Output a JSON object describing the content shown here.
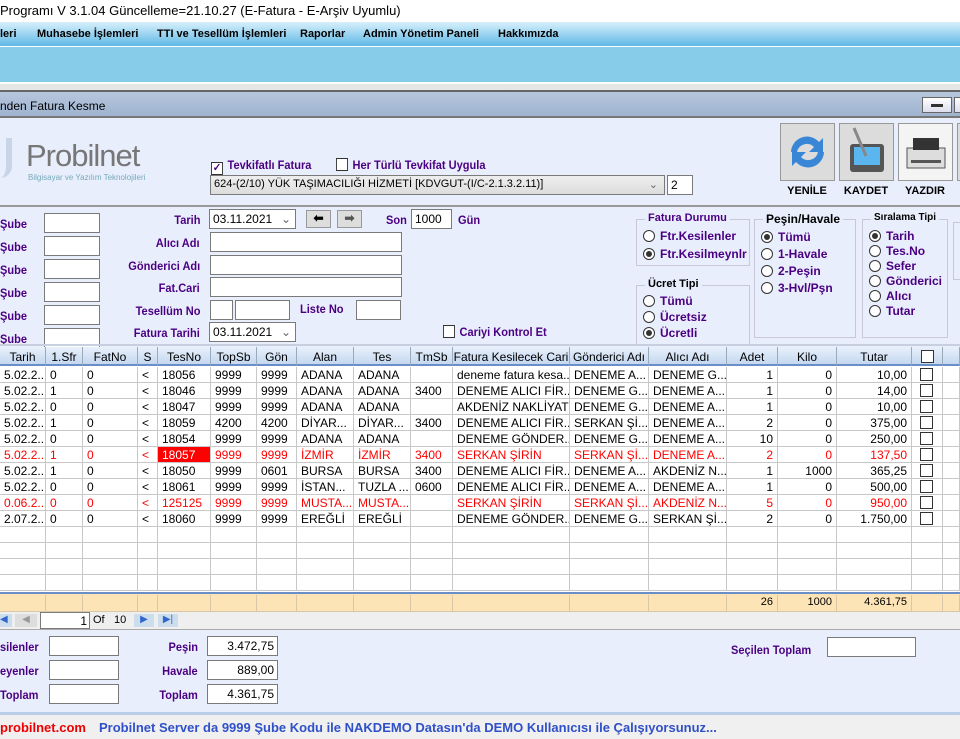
{
  "app_title": "Programı V 3.1.04 Güncelleme=21.10.27 (E-Fatura - E-Arşiv Uyumlu)",
  "menu": [
    "leri",
    "Muhasebe İşlemleri",
    "TTI ve Tesellüm İşlemleri",
    "Raporlar",
    "Admin Yönetim Paneli",
    "Hakkımızda"
  ],
  "window_title": "nden Fatura Kesme",
  "logo": {
    "name": "Probilnet",
    "tagline": "Bilgisayar ve Yazılım Teknolojileri"
  },
  "tevkifat": {
    "label": "Tevkifatlı Fatura",
    "checked": true,
    "her_turlu_label": "Her Türlü Tevkifat Uygula",
    "her_turlu_checked": false,
    "selected": "624-(2/10) YÜK TAŞIMACILIĞI HİZMETİ [KDVGUT-(I/C-2.1.3.2.11)]",
    "count": "2"
  },
  "toolbar": {
    "refresh": "YENİLE",
    "save": "KAYDET",
    "print": "YAZDIR"
  },
  "sube_labels": [
    "Şube",
    "Şube",
    "Şube",
    "Şube",
    "Şube",
    "Şube"
  ],
  "filters": {
    "tarih_label": "Tarih",
    "tarih": "03.11.2021",
    "son_label": "Son",
    "son": "1000",
    "gun_label": "Gün",
    "alici_label": "Alıcı Adı",
    "gonderici_label": "Gönderici Adı",
    "fatcari_label": "Fat.Cari",
    "tesellum_label": "Tesellüm No",
    "liste_label": "Liste No",
    "fatura_tarihi_label": "Fatura Tarihi",
    "fatura_tarihi": "03.11.2021",
    "cari_kontrol_label": "Cariyi Kontrol Et",
    "cari_kontrol": false
  },
  "fatura_durumu": {
    "title": "Fatura Durumu",
    "options": [
      "Ftr.Kesilenler",
      "Ftr.Kesilmeynlr"
    ],
    "selected": 1
  },
  "ucret_tipi": {
    "title": "Ücret Tipi",
    "options": [
      "Tümü",
      "Ücretsiz",
      "Ücretli"
    ],
    "selected": 2
  },
  "pesin_havale": {
    "title": "Peşin/Havale",
    "options": [
      "Tümü",
      "1-Havale",
      "2-Peşin",
      "3-Hvl/Pşn"
    ],
    "selected": 0
  },
  "siralama": {
    "title": "Sıralama Tipi",
    "options": [
      "Tarih",
      "Tes.No",
      "Sefer",
      "Gönderici",
      "Alıcı",
      "Tutar"
    ],
    "selected": 0
  },
  "grid": {
    "columns": [
      "Tarih",
      "1.Sfr",
      "FatNo",
      "S",
      "TesNo",
      "TopSb",
      "Gön",
      "Alan",
      "Tes",
      "TmSb",
      "Fatura Kesilecek Cari",
      "Gönderici Adı",
      "Alıcı Adı",
      "Adet",
      "Kilo",
      "Tutar",
      ""
    ],
    "rows": [
      {
        "red": false,
        "cells": [
          "5.02.2...",
          "0",
          "0",
          "<",
          "18056",
          "9999",
          "9999",
          "ADANA",
          "ADANA",
          "",
          "deneme fatura kesa...",
          "DENEME A...",
          "DENEME G...",
          "1",
          "0",
          "10,00"
        ]
      },
      {
        "red": false,
        "cells": [
          "5.02.2...",
          "1",
          "0",
          "<",
          "18046",
          "9999",
          "9999",
          "ADANA",
          "ADANA",
          "3400",
          "DENEME ALICI FİR...",
          "DENEME G...",
          "DENEME A...",
          "1",
          "0",
          "14,00"
        ]
      },
      {
        "red": false,
        "cells": [
          "5.02.2...",
          "0",
          "0",
          "<",
          "18047",
          "9999",
          "9999",
          "ADANA",
          "ADANA",
          "",
          "AKDENİZ NAKLİYAT",
          "DENEME G...",
          "DENEME A...",
          "1",
          "0",
          "10,00"
        ]
      },
      {
        "red": false,
        "cells": [
          "5.02.2...",
          "1",
          "0",
          "<",
          "18059",
          "4200",
          "4200",
          "DİYAR...",
          "DİYAR...",
          "3400",
          "DENEME ALICI FİR...",
          "SERKAN Şİ...",
          "DENEME A...",
          "2",
          "0",
          "375,00"
        ]
      },
      {
        "red": false,
        "cells": [
          "5.02.2...",
          "0",
          "0",
          "<",
          "18054",
          "9999",
          "9999",
          "ADANA",
          "ADANA",
          "",
          "DENEME GÖNDER...",
          "DENEME G...",
          "DENEME A...",
          "10",
          "0",
          "250,00"
        ]
      },
      {
        "red": true,
        "cells": [
          "5.02.2...",
          "1",
          "0",
          "<",
          "18057",
          "9999",
          "9999",
          "İZMİR",
          "İZMİR",
          "3400",
          "SERKAN ŞİRİN",
          "SERKAN Şİ...",
          "DENEME A...",
          "2",
          "0",
          "137,50"
        ]
      },
      {
        "red": false,
        "cells": [
          "5.02.2...",
          "1",
          "0",
          "<",
          "18050",
          "9999",
          "0601",
          "BURSA",
          "BURSA",
          "3400",
          "DENEME ALICI FİR...",
          "DENEME A...",
          "AKDENİZ N...",
          "1",
          "1000",
          "365,25"
        ]
      },
      {
        "red": false,
        "cells": [
          "5.02.2...",
          "0",
          "0",
          "<",
          "18061",
          "9999",
          "9999",
          "İSTAN...",
          "TUZLA ...",
          "0600",
          "DENEME ALICI FİR...",
          "DENEME A...",
          "DENEME A...",
          "1",
          "0",
          "500,00"
        ]
      },
      {
        "red": true,
        "cells": [
          "0.06.2...",
          "0",
          "0",
          "<",
          "125125",
          "9999",
          "9999",
          "MUSTA...",
          "MUSTA...",
          "",
          "SERKAN ŞİRİN",
          "SERKAN Şİ...",
          "AKDENİZ N...",
          "5",
          "0",
          "950,00"
        ]
      },
      {
        "red": false,
        "cells": [
          "2.07.2...",
          "0",
          "0",
          "<",
          "18060",
          "9999",
          "9999",
          "EREĞLİ",
          "EREĞLİ",
          "",
          "DENEME GÖNDER...",
          "DENEME G...",
          "SERKAN Şİ...",
          "2",
          "0",
          "1.750,00"
        ]
      }
    ],
    "totals": {
      "adet": "26",
      "kilo": "1000",
      "tutar": "4.361,75"
    }
  },
  "pager": {
    "page": "1",
    "of_label": "Of",
    "total": "10"
  },
  "summary": {
    "kesilenler_label": "silenler",
    "kesilmeyenler_label": "eyenler",
    "toplam_left_label": "Toplam",
    "pesin_label": "Peşin",
    "pesin": "3.472,75",
    "havale_label": "Havale",
    "havale": "889,00",
    "toplam_label": "Toplam",
    "toplam": "4.361,75",
    "secilen_label": "Seçilen Toplam"
  },
  "status": {
    "site": "probilnet.com",
    "message": "Probilnet Server da 9999 Şube Kodu ile NAKDEMO Datasın'da DEMO Kullanıcısı ile Çalışıyorsunuz..."
  },
  "colors": {
    "accent": "#4b0082",
    "highlight": "#ff0000",
    "sum_row": "#fde4b6"
  }
}
